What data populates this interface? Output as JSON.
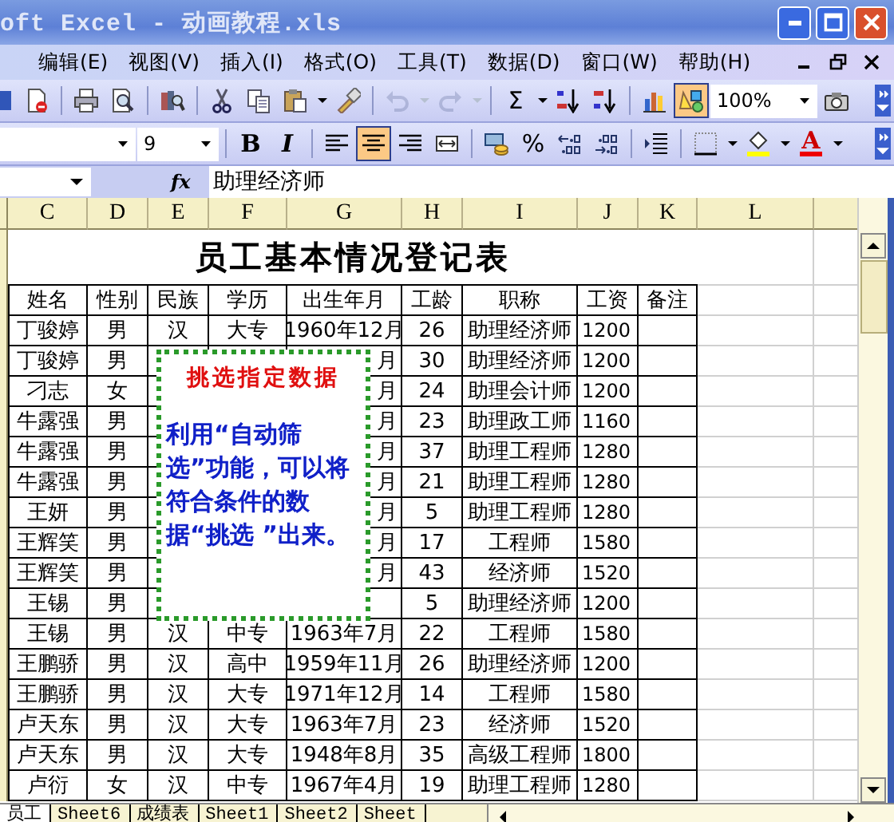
{
  "window": {
    "title": "oft Excel - 动画教程.xls"
  },
  "menu": [
    "编辑(E)",
    "视图(V)",
    "插入(I)",
    "格式(O)",
    "工具(T)",
    "数据(D)",
    "窗口(W)",
    "帮助(H)"
  ],
  "toolbars": [
    {
      "groups": [
        [
          {
            "kind": "no-doc",
            "pressed": false,
            "disabled": false
          }
        ],
        [
          {
            "kind": "print",
            "pressed": false,
            "disabled": false
          },
          {
            "kind": "preview",
            "pressed": false,
            "disabled": false
          }
        ],
        [
          {
            "kind": "research",
            "pressed": false,
            "disabled": false
          }
        ],
        [
          {
            "kind": "cut",
            "pressed": false,
            "disabled": false
          },
          {
            "kind": "copy",
            "pressed": false,
            "disabled": false
          },
          {
            "kind": "paste",
            "pressed": false,
            "disabled": false
          },
          {
            "kind": "caret",
            "pressed": false,
            "disabled": false
          },
          {
            "kind": "brush",
            "pressed": false,
            "disabled": false
          }
        ],
        [
          {
            "kind": "undo",
            "pressed": false,
            "disabled": true
          },
          {
            "kind": "caret",
            "pressed": false,
            "disabled": true
          },
          {
            "kind": "redo",
            "pressed": false,
            "disabled": true
          },
          {
            "kind": "caret",
            "pressed": false,
            "disabled": true
          }
        ],
        [
          {
            "kind": "sum",
            "label": "Σ",
            "pressed": false,
            "disabled": false
          },
          {
            "kind": "caret",
            "pressed": false,
            "disabled": false
          },
          {
            "kind": "sort-asc",
            "pressed": false,
            "disabled": false
          },
          {
            "kind": "sort-desc",
            "pressed": false,
            "disabled": false
          }
        ],
        [
          {
            "kind": "chart",
            "pressed": false,
            "disabled": false
          },
          {
            "kind": "drawing",
            "pressed": true,
            "disabled": false
          },
          {
            "kind": "zoom",
            "value": "100%"
          },
          {
            "kind": "camera",
            "pressed": false,
            "disabled": false
          }
        ]
      ]
    },
    {
      "groups": [
        [
          {
            "kind": "font"
          },
          {
            "kind": "size",
            "value": "9"
          }
        ],
        [
          {
            "kind": "bold",
            "label": "B",
            "pressed": false,
            "disabled": false
          },
          {
            "kind": "italic",
            "label": "I",
            "pressed": false,
            "disabled": false
          }
        ],
        [
          {
            "kind": "align-left",
            "pressed": false,
            "disabled": false
          },
          {
            "kind": "align-center",
            "pressed": true,
            "disabled": false
          },
          {
            "kind": "align-right",
            "pressed": false,
            "disabled": false
          },
          {
            "kind": "merge",
            "pressed": false,
            "disabled": false
          }
        ],
        [
          {
            "kind": "currency",
            "pressed": false,
            "disabled": false
          },
          {
            "kind": "percent",
            "label": "%",
            "pressed": false,
            "disabled": false
          },
          {
            "kind": "inc-decimal",
            "pressed": false,
            "disabled": false
          },
          {
            "kind": "dec-decimal",
            "pressed": false,
            "disabled": false
          }
        ],
        [
          {
            "kind": "indent",
            "pressed": false,
            "disabled": false
          }
        ],
        [
          {
            "kind": "borders",
            "pressed": false,
            "disabled": false
          },
          {
            "kind": "caret",
            "pressed": false,
            "disabled": false
          },
          {
            "kind": "fill",
            "pressed": false,
            "disabled": false
          },
          {
            "kind": "caret",
            "pressed": false,
            "disabled": false
          },
          {
            "kind": "font-color",
            "label": "A",
            "pressed": false,
            "disabled": false
          },
          {
            "kind": "caret",
            "pressed": false,
            "disabled": false
          }
        ]
      ]
    }
  ],
  "formula_bar": {
    "fx": "fx",
    "value": "助理经济师"
  },
  "sheet": {
    "columns": [
      "C",
      "D",
      "E",
      "F",
      "G",
      "H",
      "I",
      "J",
      "K",
      "L"
    ],
    "title": "员工基本情况登记表",
    "headers": [
      "姓名",
      "性别",
      "民族",
      "学历",
      "出生年月",
      "工龄",
      "职称",
      "工资",
      "备注"
    ],
    "rows": [
      {
        "name": "丁骏婷",
        "gender": "男",
        "ethnicity": "汉",
        "education": "大专",
        "birth": "1960年12月",
        "years": "26",
        "position": "助理经济师",
        "salary": "1200"
      },
      {
        "name": "丁骏婷",
        "gender": "男",
        "birth": "月",
        "years": "30",
        "position": "助理经济师",
        "salary": "1200"
      },
      {
        "name": "刁志",
        "gender": "女",
        "birth": "月",
        "years": "24",
        "position": "助理会计师",
        "salary": "1200"
      },
      {
        "name": "牛露强",
        "gender": "男",
        "birth": "月",
        "years": "23",
        "position": "助理政工师",
        "salary": "1160"
      },
      {
        "name": "牛露强",
        "gender": "男",
        "birth": "月",
        "years": "37",
        "position": "助理工程师",
        "salary": "1280"
      },
      {
        "name": "牛露强",
        "gender": "男",
        "birth": "月",
        "years": "21",
        "position": "助理工程师",
        "salary": "1280"
      },
      {
        "name": "王妍",
        "gender": "男",
        "birth": "月",
        "years": "5",
        "position": "助理工程师",
        "salary": "1280"
      },
      {
        "name": "王辉笑",
        "gender": "男",
        "birth": "月",
        "years": "17",
        "position": "工程师",
        "salary": "1580"
      },
      {
        "name": "王辉笑",
        "gender": "男",
        "birth": "月",
        "years": "43",
        "position": "经济师",
        "salary": "1520"
      },
      {
        "name": "王锡",
        "gender": "男",
        "years": "5",
        "position": "助理经济师",
        "salary": "1200"
      },
      {
        "name": "王锡",
        "gender": "男",
        "ethnicity": "汉",
        "education": "中专",
        "birth": "1963年7月",
        "years": "22",
        "position": "工程师",
        "salary": "1580"
      },
      {
        "name": "王鹏骄",
        "gender": "男",
        "ethnicity": "汉",
        "education": "高中",
        "birth": "1959年11月",
        "years": "26",
        "position": "助理经济师",
        "salary": "1200"
      },
      {
        "name": "王鹏骄",
        "gender": "男",
        "ethnicity": "汉",
        "education": "大专",
        "birth": "1971年12月",
        "years": "14",
        "position": "工程师",
        "salary": "1580"
      },
      {
        "name": "卢天东",
        "gender": "男",
        "ethnicity": "汉",
        "education": "大专",
        "birth": "1963年7月",
        "years": "23",
        "position": "经济师",
        "salary": "1520"
      },
      {
        "name": "卢天东",
        "gender": "男",
        "ethnicity": "汉",
        "education": "大专",
        "birth": "1948年8月",
        "years": "35",
        "position": "高级工程师",
        "salary": "1800"
      },
      {
        "name": "卢衍",
        "gender": "女",
        "ethnicity": "汉",
        "education": "中专",
        "birth": "1967年4月",
        "years": "19",
        "position": "助理工程师",
        "salary": "1280"
      }
    ]
  },
  "callout": {
    "title": "挑选指定数据",
    "text": "利用“自动筛选”功能，可以将符合条件的数据“挑选 ”出来。"
  },
  "sheet_tabs": [
    {
      "label": "员工",
      "selected": true
    },
    {
      "label": "Sheet6",
      "selected": false
    },
    {
      "label": "成绩表",
      "selected": false
    },
    {
      "label": "Sheet1",
      "selected": false
    },
    {
      "label": "Sheet2",
      "selected": false
    },
    {
      "label": "Sheet",
      "selected": false
    }
  ]
}
